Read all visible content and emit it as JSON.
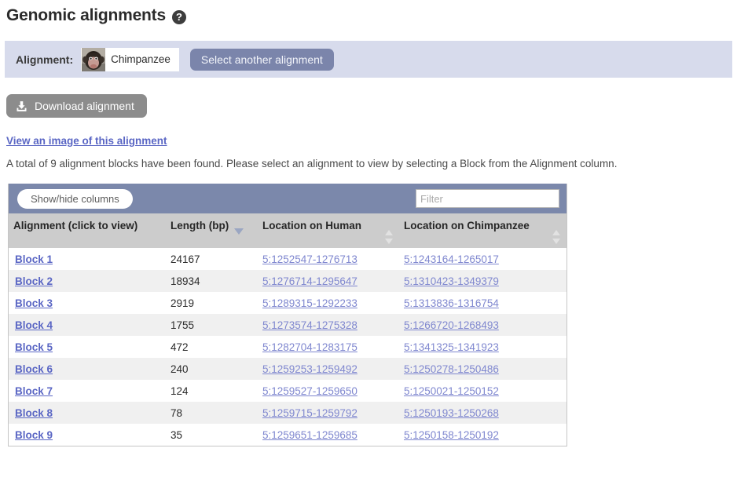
{
  "header": {
    "title": "Genomic alignments",
    "help_icon": "help-circle-icon",
    "help_glyph": "?"
  },
  "alignment_bar": {
    "label": "Alignment:",
    "species": "Chimpanzee",
    "species_thumb_icon": "chimpanzee-photo",
    "select_button": "Select another alignment",
    "background_color": "#d7dbec",
    "button_color": "#7b85ab"
  },
  "actions": {
    "download_label": "Download alignment",
    "download_icon": "download-icon",
    "download_button_color": "#8c8c8c",
    "view_image_link": "View an image of this alignment"
  },
  "info": {
    "text": "A total of 9 alignment blocks have been found. Please select an alignment to view by selecting a Block from the Alignment column."
  },
  "table": {
    "toolbar": {
      "show_hide_columns_label": "Show/hide columns",
      "filter_placeholder": "Filter",
      "filter_value": "",
      "toolbar_color": "#7b88ab"
    },
    "columns": [
      {
        "label": "Alignment (click to view)",
        "sort": "none"
      },
      {
        "label": "Length (bp)",
        "sort": "desc"
      },
      {
        "label": "Location on Human",
        "sort": "both"
      },
      {
        "label": "Location on Chimpanzee",
        "sort": "both"
      }
    ],
    "rows": [
      {
        "block": "Block 1",
        "length": "24167",
        "human": "5:1252547-1276713",
        "chimp": "5:1243164-1265017"
      },
      {
        "block": "Block 2",
        "length": "18934",
        "human": "5:1276714-1295647",
        "chimp": "5:1310423-1349379"
      },
      {
        "block": "Block 3",
        "length": "2919",
        "human": "5:1289315-1292233",
        "chimp": "5:1313836-1316754"
      },
      {
        "block": "Block 4",
        "length": "1755",
        "human": "5:1273574-1275328",
        "chimp": "5:1266720-1268493"
      },
      {
        "block": "Block 5",
        "length": "472",
        "human": "5:1282704-1283175",
        "chimp": "5:1341325-1341923"
      },
      {
        "block": "Block 6",
        "length": "240",
        "human": "5:1259253-1259492",
        "chimp": "5:1250278-1250486"
      },
      {
        "block": "Block 7",
        "length": "124",
        "human": "5:1259527-1259650",
        "chimp": "5:1250021-1250152"
      },
      {
        "block": "Block 8",
        "length": "78",
        "human": "5:1259715-1259792",
        "chimp": "5:1250193-1250268"
      },
      {
        "block": "Block 9",
        "length": "35",
        "human": "5:1259651-1259685",
        "chimp": "5:1250158-1250192"
      }
    ]
  }
}
